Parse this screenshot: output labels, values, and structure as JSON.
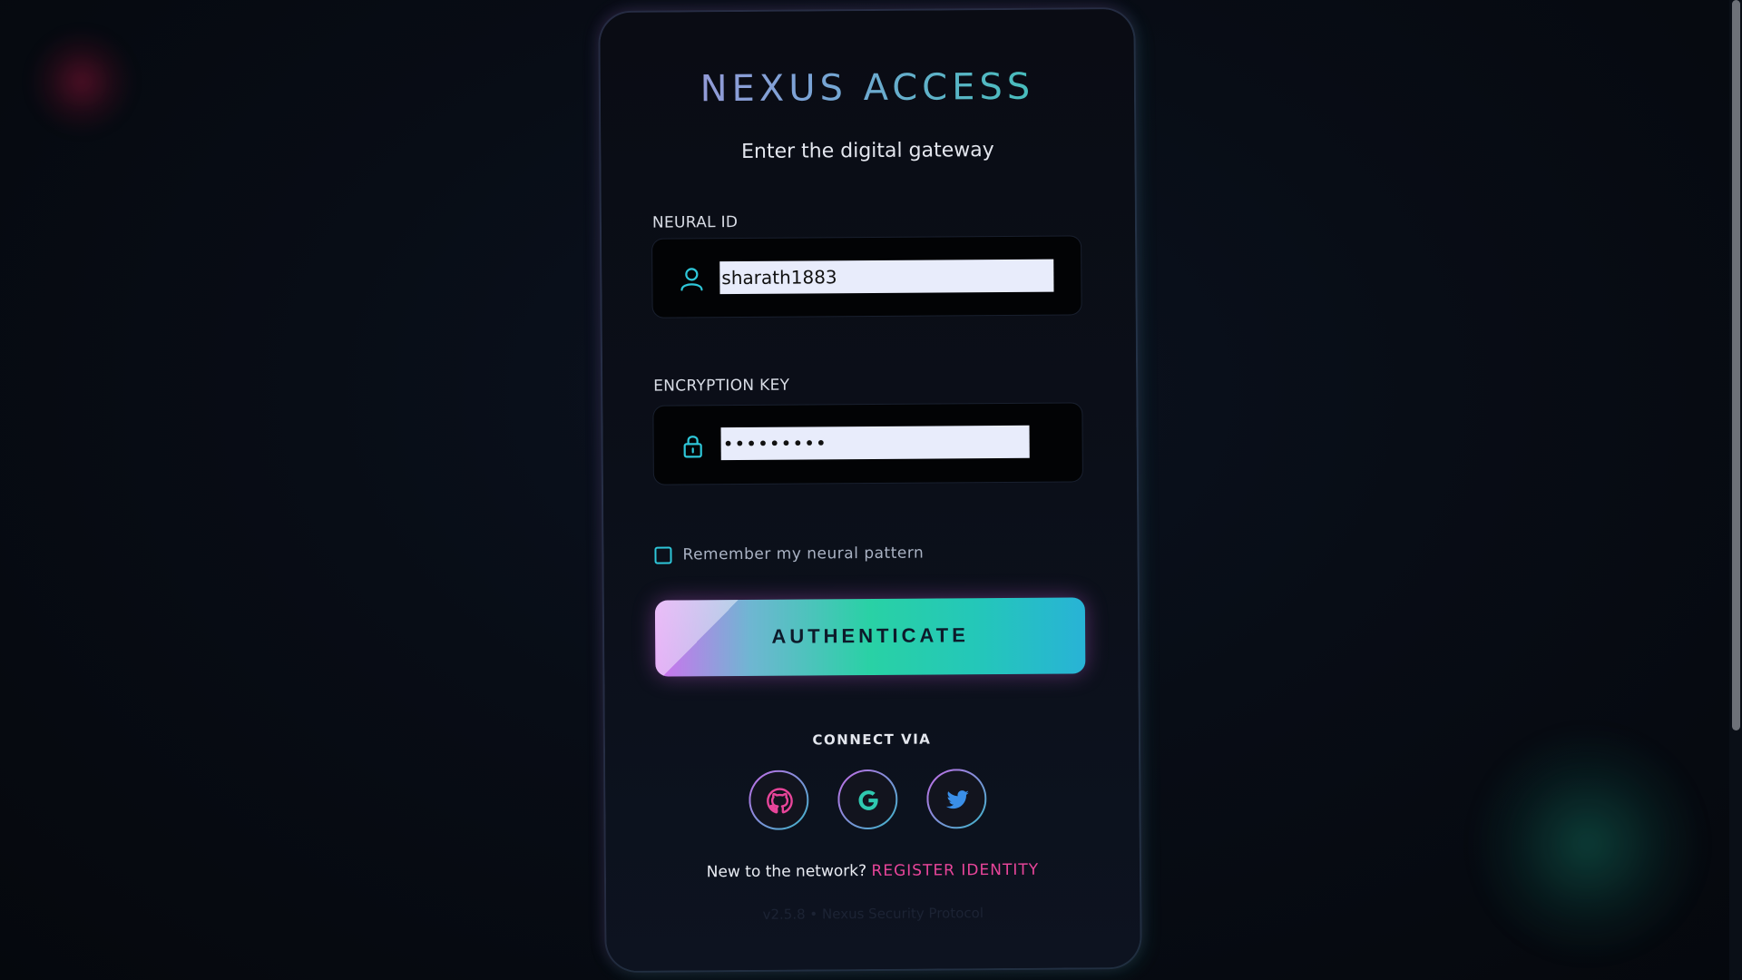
{
  "login": {
    "title": "NEXUS ACCESS",
    "subtitle": "Enter the digital gateway",
    "neural_id": {
      "label": "NEURAL ID",
      "value": "sharath1883",
      "icon": "user-icon"
    },
    "encryption_key": {
      "label": "ENCRYPTION KEY",
      "value": "•••••••••",
      "icon": "lock-icon"
    },
    "remember_label": "Remember my neural pattern",
    "remember_checked": false,
    "authenticate_label": "AUTHENTICATE",
    "connect_label": "CONNECT VIA",
    "social": [
      {
        "name": "github",
        "icon": "github-icon",
        "color": "#e8459a"
      },
      {
        "name": "google",
        "icon": "google-icon",
        "color": "#2fc9b0"
      },
      {
        "name": "twitter",
        "icon": "twitter-icon",
        "color": "#3a8fe8"
      }
    ],
    "register_prefix": "New to the network?",
    "register_link": "REGISTER IDENTITY",
    "footer": "v2.5.8 • Nexus Security Protocol"
  },
  "colors": {
    "accent_teal": "#2fc9b0",
    "accent_pink": "#e8459a",
    "accent_purple": "#c66be8",
    "background": "#070b12"
  }
}
